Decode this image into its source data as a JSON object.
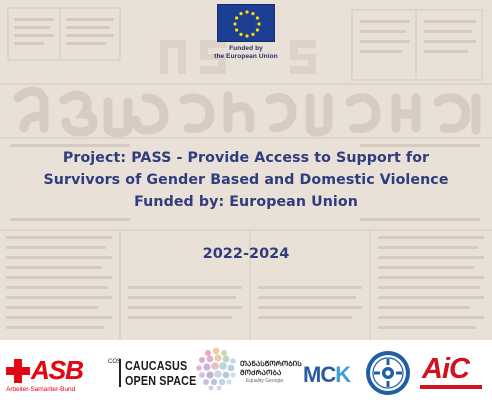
{
  "funder": {
    "flag_icon": "eu-flag-icon",
    "caption_line1": "Funded by",
    "caption_line2": "the European Union",
    "flag_color": "#1c3f94",
    "star_color": "#ffdd00"
  },
  "project": {
    "line1": "Project: PASS - Provide Access to Support for",
    "line2": "Survivors of Gender Based and Domestic Violence",
    "line3": "Funded by: European Union",
    "period": "2022-2024",
    "text_color": "#2f3c7e"
  },
  "background": {
    "headline_glyphs": "ᲮᲐᲠᲗᲕᲔᲚᲘ ᲥᲐᲚᲘ",
    "masthead_glyphs": "ᲮᲐᲡ"
  },
  "partners": [
    {
      "id": "asb",
      "name": "ASB",
      "sub": "Arbeiter-Samariter-Bund",
      "color": "#e30613"
    },
    {
      "id": "cos",
      "vertical": "COS",
      "line1": "CAUCASUS",
      "line2": "OPEN SPACE"
    },
    {
      "id": "equality",
      "name_line1": "ᲗᲐᲜᲐᲡᲬᲝᲠᲝᲑᲘᲡ",
      "name_line2": "ᲛᲝᲫᲠᲐᲝᲑᲐ",
      "sub": "Equality Georgia"
    },
    {
      "id": "mck",
      "part1": "MC",
      "part2": "K"
    },
    {
      "id": "emblem",
      "icon": "round-emblem-icon"
    },
    {
      "id": "aic",
      "name": "AiC"
    }
  ]
}
